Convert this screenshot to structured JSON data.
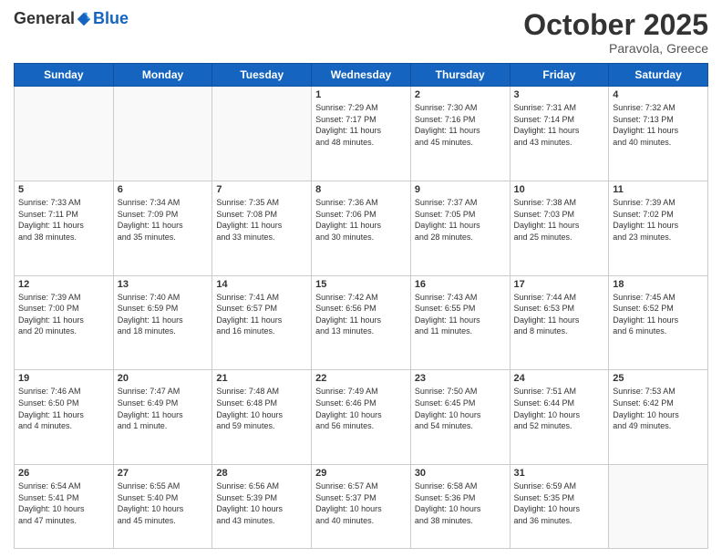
{
  "header": {
    "logo_general": "General",
    "logo_blue": "Blue",
    "month": "October 2025",
    "location": "Paravola, Greece"
  },
  "days_of_week": [
    "Sunday",
    "Monday",
    "Tuesday",
    "Wednesday",
    "Thursday",
    "Friday",
    "Saturday"
  ],
  "weeks": [
    [
      {
        "day": "",
        "info": ""
      },
      {
        "day": "",
        "info": ""
      },
      {
        "day": "",
        "info": ""
      },
      {
        "day": "1",
        "info": "Sunrise: 7:29 AM\nSunset: 7:17 PM\nDaylight: 11 hours\nand 48 minutes."
      },
      {
        "day": "2",
        "info": "Sunrise: 7:30 AM\nSunset: 7:16 PM\nDaylight: 11 hours\nand 45 minutes."
      },
      {
        "day": "3",
        "info": "Sunrise: 7:31 AM\nSunset: 7:14 PM\nDaylight: 11 hours\nand 43 minutes."
      },
      {
        "day": "4",
        "info": "Sunrise: 7:32 AM\nSunset: 7:13 PM\nDaylight: 11 hours\nand 40 minutes."
      }
    ],
    [
      {
        "day": "5",
        "info": "Sunrise: 7:33 AM\nSunset: 7:11 PM\nDaylight: 11 hours\nand 38 minutes."
      },
      {
        "day": "6",
        "info": "Sunrise: 7:34 AM\nSunset: 7:09 PM\nDaylight: 11 hours\nand 35 minutes."
      },
      {
        "day": "7",
        "info": "Sunrise: 7:35 AM\nSunset: 7:08 PM\nDaylight: 11 hours\nand 33 minutes."
      },
      {
        "day": "8",
        "info": "Sunrise: 7:36 AM\nSunset: 7:06 PM\nDaylight: 11 hours\nand 30 minutes."
      },
      {
        "day": "9",
        "info": "Sunrise: 7:37 AM\nSunset: 7:05 PM\nDaylight: 11 hours\nand 28 minutes."
      },
      {
        "day": "10",
        "info": "Sunrise: 7:38 AM\nSunset: 7:03 PM\nDaylight: 11 hours\nand 25 minutes."
      },
      {
        "day": "11",
        "info": "Sunrise: 7:39 AM\nSunset: 7:02 PM\nDaylight: 11 hours\nand 23 minutes."
      }
    ],
    [
      {
        "day": "12",
        "info": "Sunrise: 7:39 AM\nSunset: 7:00 PM\nDaylight: 11 hours\nand 20 minutes."
      },
      {
        "day": "13",
        "info": "Sunrise: 7:40 AM\nSunset: 6:59 PM\nDaylight: 11 hours\nand 18 minutes."
      },
      {
        "day": "14",
        "info": "Sunrise: 7:41 AM\nSunset: 6:57 PM\nDaylight: 11 hours\nand 16 minutes."
      },
      {
        "day": "15",
        "info": "Sunrise: 7:42 AM\nSunset: 6:56 PM\nDaylight: 11 hours\nand 13 minutes."
      },
      {
        "day": "16",
        "info": "Sunrise: 7:43 AM\nSunset: 6:55 PM\nDaylight: 11 hours\nand 11 minutes."
      },
      {
        "day": "17",
        "info": "Sunrise: 7:44 AM\nSunset: 6:53 PM\nDaylight: 11 hours\nand 8 minutes."
      },
      {
        "day": "18",
        "info": "Sunrise: 7:45 AM\nSunset: 6:52 PM\nDaylight: 11 hours\nand 6 minutes."
      }
    ],
    [
      {
        "day": "19",
        "info": "Sunrise: 7:46 AM\nSunset: 6:50 PM\nDaylight: 11 hours\nand 4 minutes."
      },
      {
        "day": "20",
        "info": "Sunrise: 7:47 AM\nSunset: 6:49 PM\nDaylight: 11 hours\nand 1 minute."
      },
      {
        "day": "21",
        "info": "Sunrise: 7:48 AM\nSunset: 6:48 PM\nDaylight: 10 hours\nand 59 minutes."
      },
      {
        "day": "22",
        "info": "Sunrise: 7:49 AM\nSunset: 6:46 PM\nDaylight: 10 hours\nand 56 minutes."
      },
      {
        "day": "23",
        "info": "Sunrise: 7:50 AM\nSunset: 6:45 PM\nDaylight: 10 hours\nand 54 minutes."
      },
      {
        "day": "24",
        "info": "Sunrise: 7:51 AM\nSunset: 6:44 PM\nDaylight: 10 hours\nand 52 minutes."
      },
      {
        "day": "25",
        "info": "Sunrise: 7:53 AM\nSunset: 6:42 PM\nDaylight: 10 hours\nand 49 minutes."
      }
    ],
    [
      {
        "day": "26",
        "info": "Sunrise: 6:54 AM\nSunset: 5:41 PM\nDaylight: 10 hours\nand 47 minutes."
      },
      {
        "day": "27",
        "info": "Sunrise: 6:55 AM\nSunset: 5:40 PM\nDaylight: 10 hours\nand 45 minutes."
      },
      {
        "day": "28",
        "info": "Sunrise: 6:56 AM\nSunset: 5:39 PM\nDaylight: 10 hours\nand 43 minutes."
      },
      {
        "day": "29",
        "info": "Sunrise: 6:57 AM\nSunset: 5:37 PM\nDaylight: 10 hours\nand 40 minutes."
      },
      {
        "day": "30",
        "info": "Sunrise: 6:58 AM\nSunset: 5:36 PM\nDaylight: 10 hours\nand 38 minutes."
      },
      {
        "day": "31",
        "info": "Sunrise: 6:59 AM\nSunset: 5:35 PM\nDaylight: 10 hours\nand 36 minutes."
      },
      {
        "day": "",
        "info": ""
      }
    ]
  ]
}
